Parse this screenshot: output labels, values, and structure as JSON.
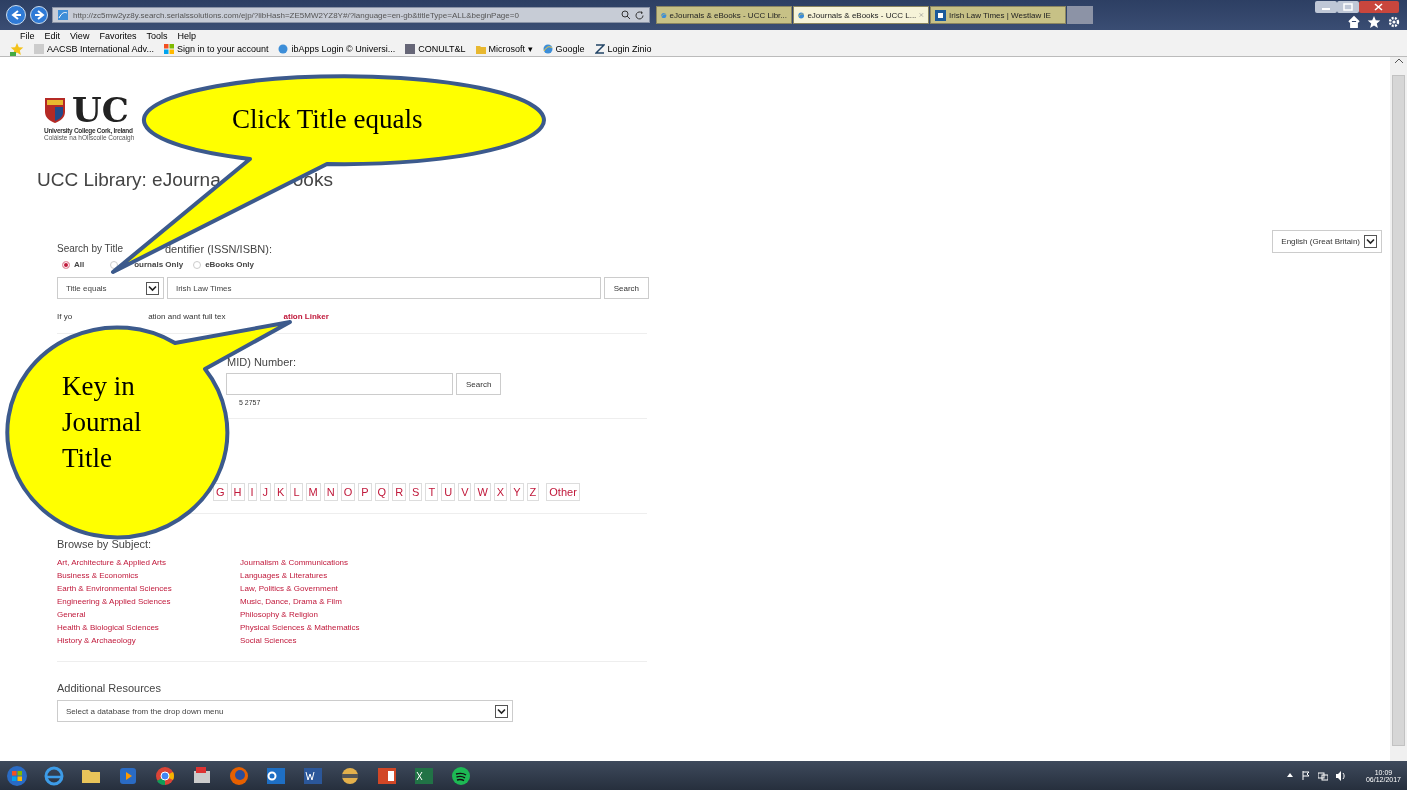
{
  "browser": {
    "address": "http://zc5mw2yz8y.search.serialssolutions.com/ejp/?libHash=ZE5MW2YZ8Y#/?language=en-gb&titleType=ALL&beginPage=0",
    "tabs": [
      {
        "label": "eJournals & eBooks - UCC Libr...",
        "selected": false
      },
      {
        "label": "eJournals & eBooks - UCC L...",
        "selected": true
      },
      {
        "label": "Irish Law Times | Westlaw IE",
        "selected": false
      }
    ],
    "menu": [
      "File",
      "Edit",
      "View",
      "Favorites",
      "Tools",
      "Help"
    ],
    "favorites": [
      "AACSB International Adv...",
      "Sign in to your account",
      "ibApps Login © Universi...",
      "CONULT&L",
      "Microsoft ▾",
      "Google",
      "Login Zinio"
    ]
  },
  "page": {
    "logo": {
      "mark": "UC",
      "line_1": "University College Cork, Ireland",
      "line_2": "Coláiste na hOllscoile Corcaigh"
    },
    "title_parts": [
      "UCC Library: eJourna",
      "ooks"
    ],
    "language": "English (Great Britain)",
    "search": {
      "heading_parts": [
        "Search by Title",
        "dentifier (ISSN/ISBN):"
      ],
      "scopes": [
        {
          "label": "All",
          "selected": true
        },
        {
          "label": "ournals Only",
          "selected": false
        },
        {
          "label": "eBooks Only",
          "selected": false
        }
      ],
      "field_type": "Title equals",
      "query": "Irish Law Times",
      "button": "Search",
      "note_parts": [
        "If yo",
        "ation and want full tex"
      ],
      "note_link": "ation Linker"
    },
    "pmid": {
      "heading": "MID) Number:",
      "button": "Search",
      "hint": "5 2757"
    },
    "letters": [
      "G",
      "H",
      "I",
      "J",
      "K",
      "L",
      "M",
      "N",
      "O",
      "P",
      "Q",
      "R",
      "S",
      "T",
      "U",
      "V",
      "W",
      "X",
      "Y",
      "Z",
      "Other"
    ],
    "subjects": {
      "heading": "Browse by Subject:",
      "column_1": [
        "Art, Architecture & Applied Arts",
        "Business & Economics",
        "Earth & Environmental Sciences",
        "Engineering & Applied Sciences",
        "General",
        "Health & Biological Sciences",
        "History & Archaeology"
      ],
      "column_2": [
        "Journalism & Communications",
        "Languages & Literatures",
        "Law, Politics & Government",
        "Music, Dance, Drama & Film",
        "Philosophy & Religion",
        "Physical Sciences & Mathematics",
        "Social Sciences"
      ]
    },
    "resources": {
      "heading": "Additional Resources",
      "select": "Select a database from the drop down menu"
    }
  },
  "callouts": [
    {
      "text": "Click Title equals"
    },
    {
      "text": "Key in Journal Title"
    }
  ],
  "taskbar": {
    "time": "10:09",
    "date": "06/12/2017"
  }
}
